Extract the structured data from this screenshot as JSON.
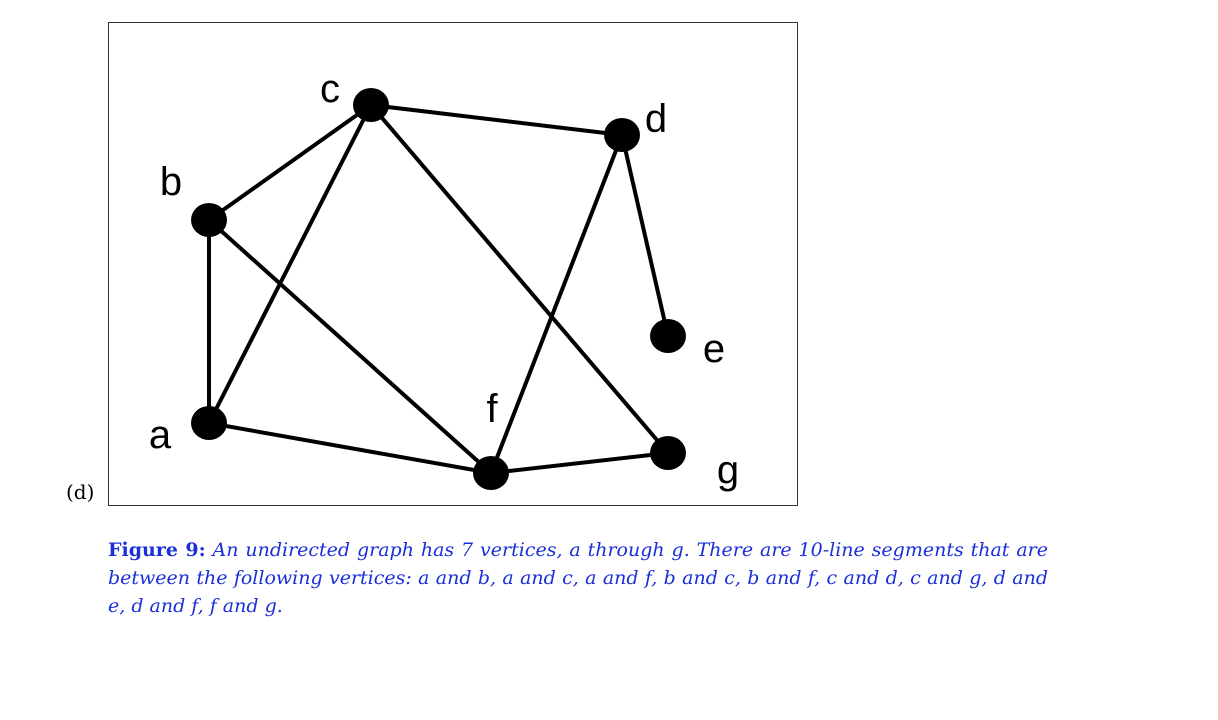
{
  "subfigure_label": "(d)",
  "graph": {
    "vertices": [
      {
        "id": "a",
        "label": "a"
      },
      {
        "id": "b",
        "label": "b"
      },
      {
        "id": "c",
        "label": "c"
      },
      {
        "id": "d",
        "label": "d"
      },
      {
        "id": "e",
        "label": "e"
      },
      {
        "id": "f",
        "label": "f"
      },
      {
        "id": "g",
        "label": "g"
      }
    ],
    "edges": [
      [
        "a",
        "b"
      ],
      [
        "a",
        "c"
      ],
      [
        "a",
        "f"
      ],
      [
        "b",
        "c"
      ],
      [
        "b",
        "f"
      ],
      [
        "c",
        "d"
      ],
      [
        "c",
        "g"
      ],
      [
        "d",
        "e"
      ],
      [
        "d",
        "f"
      ],
      [
        "f",
        "g"
      ]
    ]
  },
  "caption": {
    "label": "Figure 9:",
    "text": "An undirected graph has 7 vertices, a through g. There are 10-line segments that are between the following vertices: a and b, a and c, a and f, b and c, b and f, c and d, c and g, d and e, d and f, f and g."
  }
}
